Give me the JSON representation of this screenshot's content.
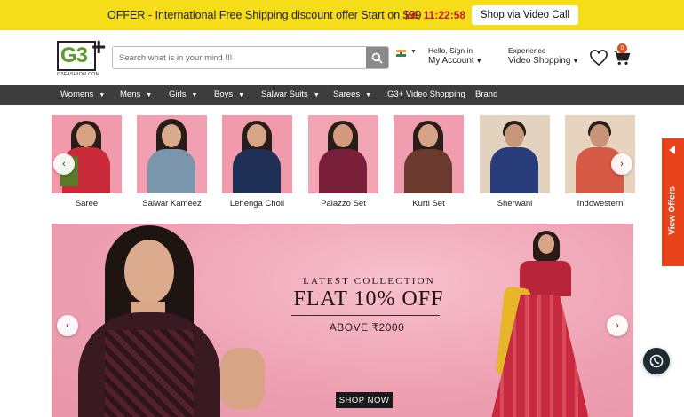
{
  "offer_bar": {
    "text": "OFFER - International Free Shipping discount offer Start on $99",
    "timer": "2d, 11:22:58",
    "button_label": "Shop via Video Call",
    "color": "#f5dd1a"
  },
  "logo": {
    "text": "G3",
    "plus": "+",
    "subtext": "G3FASHION.COM"
  },
  "search": {
    "placeholder": "Search what is in your mind !!!",
    "icon": "search-icon"
  },
  "account": {
    "line1": "Hello, Sign in",
    "line2": "My Account"
  },
  "experience": {
    "line1": "Experience",
    "line2": "Video Shopping"
  },
  "cart": {
    "count": "0"
  },
  "nav": {
    "items": [
      {
        "label": "Womens",
        "dropdown": true
      },
      {
        "label": "Mens",
        "dropdown": true
      },
      {
        "label": "Girls",
        "dropdown": true
      },
      {
        "label": "Boys",
        "dropdown": true
      },
      {
        "label": "Salwar Suits",
        "dropdown": true
      },
      {
        "label": "Sarees",
        "dropdown": true
      },
      {
        "label": "G3+ Video Shopping",
        "dropdown": false
      },
      {
        "label": "Brand",
        "dropdown": false
      }
    ]
  },
  "categories": [
    {
      "label": "Saree"
    },
    {
      "label": "Salwar Kameez"
    },
    {
      "label": "Lehenga Choli"
    },
    {
      "label": "Palazzo Set"
    },
    {
      "label": "Kurti Set"
    },
    {
      "label": "Sherwani"
    },
    {
      "label": "Indowestern"
    }
  ],
  "banner": {
    "line1": "LATEST COLLECTION",
    "line2": "FLAT 10% OFF",
    "line3": "ABOVE ₹2000",
    "button": "SHOP NOW"
  },
  "side_offers": {
    "label": "View Offers",
    "color": "#e8431a"
  },
  "carousel": {
    "prev": "‹",
    "next": "›"
  }
}
